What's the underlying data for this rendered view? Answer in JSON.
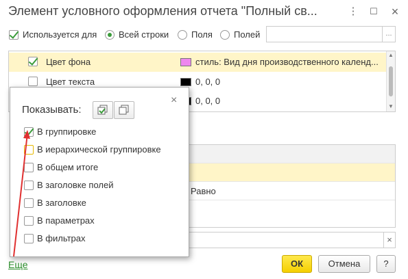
{
  "window": {
    "title": "Элемент условного оформления отчета \"Полный св..."
  },
  "options": {
    "use_for_label": "Используется для",
    "all_rows_label": "Всей строки",
    "fields_label": "Поля",
    "field_label": "Полей",
    "more_btn": "..."
  },
  "appearance_rows": [
    {
      "name": "Цвет фона",
      "value": "стиль: Вид дня производственного календ...",
      "checked": true,
      "color": "#ee88ee"
    },
    {
      "name": "Цвет текста",
      "value": "0, 0, 0",
      "checked": false,
      "color": "#000000"
    },
    {
      "name": "",
      "value": "0, 0, 0",
      "checked": false,
      "color": "#000000"
    }
  ],
  "popup": {
    "title": "Показывать:",
    "close": "×",
    "items": [
      {
        "label": "В группировке",
        "checked": true
      },
      {
        "label": "В иерархической группировке",
        "checked": false
      },
      {
        "label": "В общем итоге",
        "checked": false
      },
      {
        "label": "В заголовке полей",
        "checked": false
      },
      {
        "label": "В заголовке",
        "checked": false
      },
      {
        "label": "В параметрах",
        "checked": false
      },
      {
        "label": "В фильтрах",
        "checked": false
      }
    ]
  },
  "condition": {
    "comparison": "Равно"
  },
  "footer": {
    "more_link": "Еще",
    "ok": "ОК",
    "cancel": "Отмена",
    "help": "?",
    "clear": "×"
  },
  "colors": {
    "accent": "#f5cf00",
    "selection": "#fff5c8",
    "checkmark": "#3a9b3a",
    "annotation_arrow": "#e03030"
  }
}
